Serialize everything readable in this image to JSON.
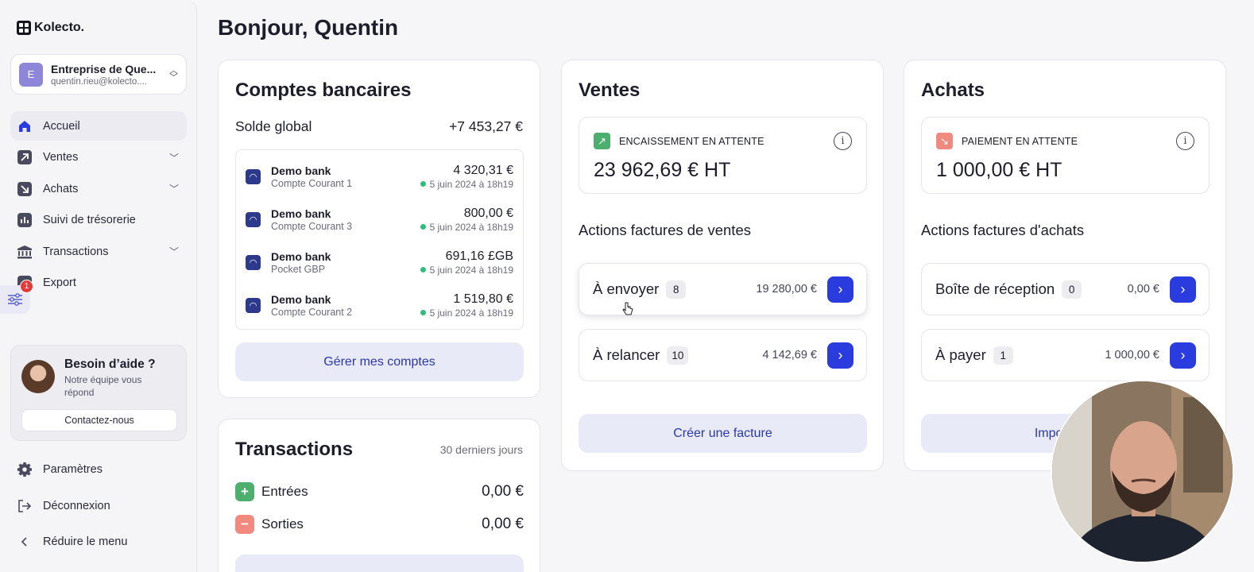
{
  "app": {
    "logo_text": "Kolecto."
  },
  "company": {
    "initial": "E",
    "name": "Entreprise de Que...",
    "email": "quentin.rieu@kolecto...."
  },
  "sidebar": {
    "items": [
      {
        "label": "Accueil",
        "icon": "home-icon",
        "active": true
      },
      {
        "label": "Ventes",
        "icon": "arrow-up-right-icon",
        "chevron": true
      },
      {
        "label": "Achats",
        "icon": "arrow-down-right-icon",
        "chevron": true
      },
      {
        "label": "Suivi de trésorerie",
        "icon": "bar-chart-icon"
      },
      {
        "label": "Transactions",
        "icon": "bank-icon",
        "chevron": true
      },
      {
        "label": "Export",
        "icon": "export-icon"
      }
    ],
    "notification_count": "1",
    "help": {
      "title": "Besoin d’aide ?",
      "subtitle": "Notre équipe vous répond",
      "button": "Contactez-nous"
    },
    "bottom": [
      {
        "label": "Paramètres",
        "icon": "gear-icon"
      },
      {
        "label": "Déconnexion",
        "icon": "logout-icon"
      },
      {
        "label": "Réduire le menu",
        "icon": "chevron-left-icon"
      }
    ]
  },
  "greeting": "Bonjour, Quentin",
  "bank": {
    "title": "Comptes bancaires",
    "solde_label": "Solde global",
    "solde_value": "+7 453,27 €",
    "accounts": [
      {
        "name": "Demo bank",
        "type": "Compte Courant 1",
        "amount": "4 320,31 €",
        "date": "5 juin 2024 à 18h19"
      },
      {
        "name": "Demo bank",
        "type": "Compte Courant 3",
        "amount": "800,00 €",
        "date": "5 juin 2024 à 18h19"
      },
      {
        "name": "Demo bank",
        "type": "Pocket GBP",
        "amount": "691,16 £GB",
        "date": "5 juin 2024 à 18h19"
      },
      {
        "name": "Demo bank",
        "type": "Compte Courant 2",
        "amount": "1 519,80 €",
        "date": "5 juin 2024 à 18h19"
      }
    ],
    "manage_button": "Gérer mes comptes"
  },
  "transactions": {
    "title": "Transactions",
    "period": "30 derniers jours",
    "in_label": "Entrées",
    "in_value": "0,00 €",
    "out_label": "Sorties",
    "out_value": "0,00 €"
  },
  "ventes": {
    "title": "Ventes",
    "pending_label": "ENCAISSEMENT EN ATTENTE",
    "pending_amount": "23 962,69 € HT",
    "actions_title": "Actions factures de ventes",
    "actions": [
      {
        "label": "À envoyer",
        "count": "8",
        "amount": "19 280,00 €"
      },
      {
        "label": "À relancer",
        "count": "10",
        "amount": "4 142,69 €"
      }
    ],
    "button": "Créer une facture"
  },
  "achats": {
    "title": "Achats",
    "pending_label": "PAIEMENT EN ATTENTE",
    "pending_amount": "1 000,00 € HT",
    "actions_title": "Actions factures d'achats",
    "actions": [
      {
        "label": "Boîte de réception",
        "count": "0",
        "amount": "0,00 €"
      },
      {
        "label": "À payer",
        "count": "1",
        "amount": "1 000,00 €"
      }
    ],
    "button": "Importer m"
  },
  "colors": {
    "accent": "#2a3cdd",
    "soft": "#e9eaf8",
    "green": "#2dbf7a",
    "sales_icon": "#4caf6e",
    "purchase_icon": "#f08a80"
  }
}
